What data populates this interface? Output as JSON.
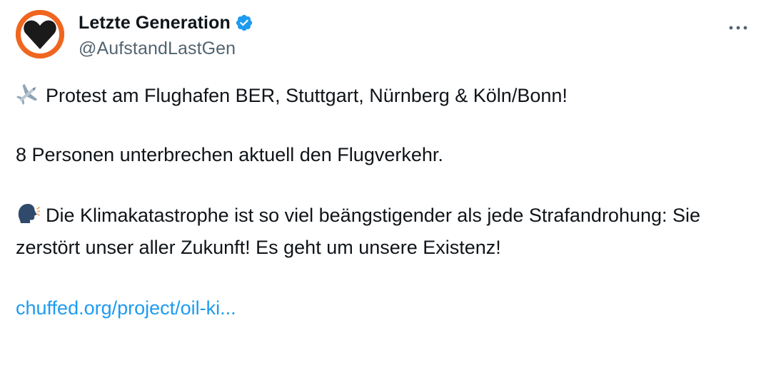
{
  "author": {
    "display_name": "Letzte Generation",
    "handle": "@AufstandLastGen",
    "verified": true,
    "avatar_icon": "orange-circle-black-heart-icon",
    "avatar_color": "#f0661f"
  },
  "tweet": {
    "line1_emoji": "airplane-emoji",
    "line1": "Protest am Flughafen BER, Stuttgart, Nürnberg & Köln/Bonn!",
    "line2": "8 Personen unterbrechen aktuell den Flugverkehr.",
    "line3_emoji": "speaking-head-emoji",
    "line3": "Die Klimakatastrophe ist so viel beängstigender als jede Strafandrohung: Sie zerstört unser aller Zukunft! Es geht um unsere Existenz!",
    "link": "chuffed.org/project/oil-ki..."
  },
  "colors": {
    "text": "#0f1419",
    "secondary": "#536471",
    "link": "#1d9bf0",
    "verified": "#1d9bf0"
  }
}
